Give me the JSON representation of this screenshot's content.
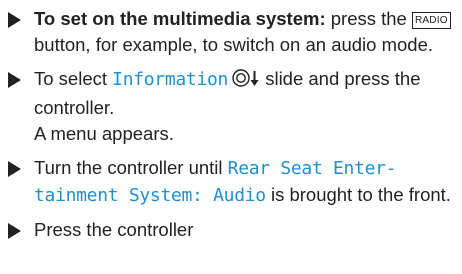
{
  "accent_color": "#1f8fcf",
  "steps": [
    {
      "bold_lead": "To set on the multimedia system:",
      "text_a": " press the ",
      "button_label": "RADIO",
      "text_b": " button, for example, to switch on an audio mode."
    },
    {
      "text_a": "To select ",
      "display_text": "Information",
      "controller_icon": "controller-dial-icon",
      "text_b": " slide and press the controller.",
      "result": "A menu appears."
    },
    {
      "text_a": "Turn the controller until ",
      "display_text": "Rear Seat Enter-tainment System: Audio",
      "text_b": " is brought to the front."
    },
    {
      "text_a": "Press the controller"
    }
  ]
}
